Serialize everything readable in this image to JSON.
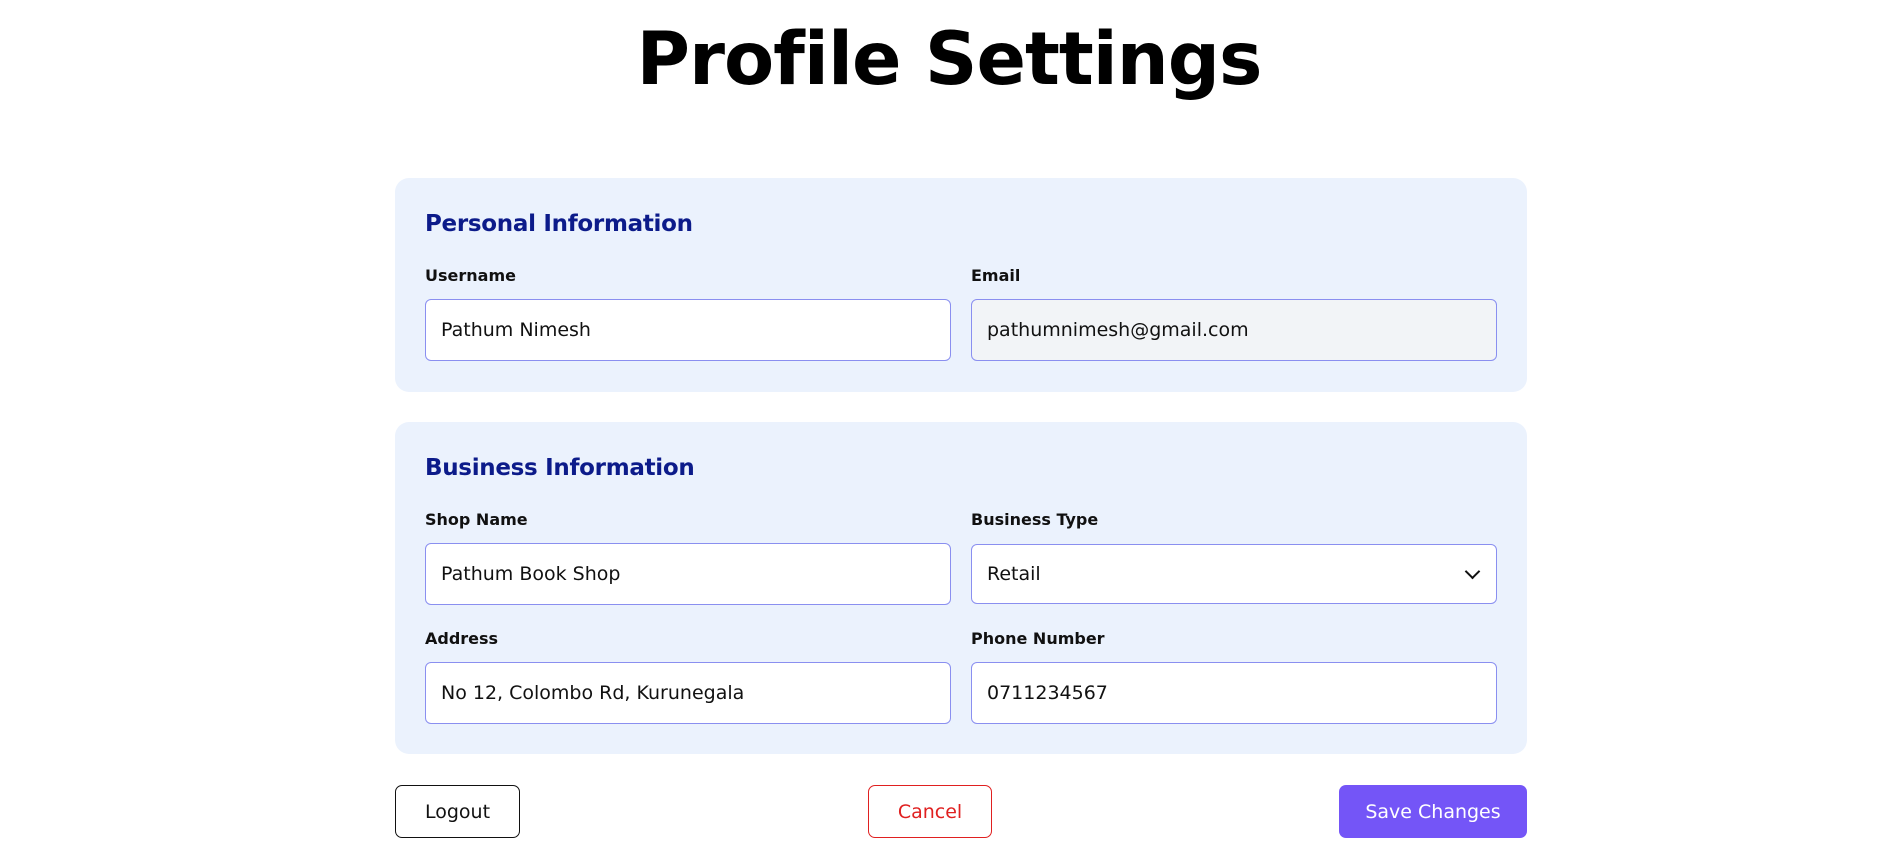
{
  "page": {
    "title": "Profile Settings"
  },
  "personal": {
    "title": "Personal Information",
    "username": {
      "label": "Username",
      "value": "Pathum Nimesh"
    },
    "email": {
      "label": "Email",
      "value": "pathumnimesh@gmail.com"
    }
  },
  "business": {
    "title": "Business Information",
    "shop_name": {
      "label": "Shop Name",
      "value": "Pathum Book Shop"
    },
    "business_type": {
      "label": "Business Type",
      "value": "Retail"
    },
    "address": {
      "label": "Address",
      "value": "No 12, Colombo Rd, Kurunegala"
    },
    "phone": {
      "label": "Phone Number",
      "value": "0711234567"
    }
  },
  "actions": {
    "logout_label": "Logout",
    "cancel_label": "Cancel",
    "save_label": "Save Changes"
  },
  "colors": {
    "card_background": "#ebf2fd",
    "section_title": "#0c1b8a",
    "input_border": "#8a8ff0",
    "cancel": "#e02020",
    "save_button": "#7455f7"
  }
}
